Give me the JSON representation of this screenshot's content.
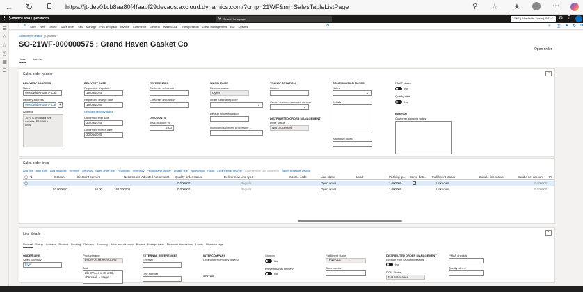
{
  "browser": {
    "url": "https://jt-dev01cb8aa80f4faabf29devaos.axcloud.dynamics.com/?cmp=21WF&mi=SalesTableListPage"
  },
  "appbar": {
    "app_name": "Finance and Operations",
    "search_placeholder": "Search for a page",
    "company": "21WF | Worldwide Foam (JBT US)"
  },
  "actionpane": {
    "items": [
      "Save",
      "New",
      "Delete",
      "Sales order",
      "Sell",
      "Manage",
      "Pick and pack",
      "Invoice",
      "Commerce",
      "General",
      "Warehouse",
      "Transportation",
      "Credit management",
      "EDI",
      "Options"
    ]
  },
  "page": {
    "breadcrumb": "Sales order details",
    "updated": "| Updated *",
    "title": "SO-21WF-000000575 : Grand Haven Gasket Co",
    "status": "Open order",
    "tabs": [
      "Lines",
      "Header"
    ]
  },
  "header": {
    "section_title": "Sales order header",
    "delivery_address": {
      "heading": "DELIVERY ADDRESS",
      "name_label": "Name",
      "name_value": "Worldwide Foam - Cali",
      "delivery_label": "Delivery address",
      "delivery_value": "Worldwide Foam - Cali",
      "address_label": "Address",
      "address_lines": [
        "1570 S Archibald Ave",
        "Arcadia, PA 00613",
        "USA"
      ]
    },
    "delivery_date": {
      "heading": "DELIVERY DATE",
      "req_ship_label": "Requested ship date",
      "req_ship_value": "19/05/2025",
      "req_receipt_label": "Requested receipt date",
      "req_receipt_value": "19/05/2025",
      "simulate": "Simulate delivery dates",
      "conf_ship_label": "Confirmed ship date",
      "conf_ship_value": "30/05/2025",
      "conf_receipt_label": "Confirmed receipt date",
      "conf_receipt_value": "30/05/2025"
    },
    "references": {
      "heading": "REFERENCES",
      "cust_ref_label": "Customer reference",
      "cust_req_label": "Customer requisition",
      "discounts_heading": "DISCOUNTS",
      "total_disc_label": "Total discount %",
      "total_disc_value": "2.00"
    },
    "warehouse": {
      "heading": "WAREHOUSE",
      "release_label": "Release status",
      "release_value": "Open",
      "fulfill_label": "Order fulfillment policy",
      "default_fulfill_label": "Default fulfillment policy",
      "outbound_label": "Outbound shipment processing ..."
    },
    "transportation": {
      "heading": "TRANSPORTATION",
      "routes_label": "Routes",
      "carrier_label": "Carrier customer account number",
      "dist_heading": "DISTRIBUTED ORDER MANAGEMENT",
      "dom_label": "DOM Status",
      "dom_value": "Not processed"
    },
    "confirmation": {
      "heading": "CONFIRMATION NOTES",
      "notes_label": "Notes",
      "details_label": "Details",
      "additional_label": "Additional notes"
    },
    "misc": {
      "pmap_label": "PMAP check",
      "pmap_value": "No",
      "quality_label": "Quality alert",
      "quality_value": "No",
      "banyan_heading": "BANYAN",
      "cust_ship_notes_label": "Customer shipping notes"
    }
  },
  "lines": {
    "section_title": "Sales order lines",
    "toolbar": [
      "Add line",
      "Add lines",
      "Add products",
      "Remove",
      "Deneals",
      "Sales order line",
      "Financials",
      "Inventory",
      "Product and supply",
      "Update line",
      "Warehouse",
      "Retail",
      "Engineering change",
      "Add revenue split child item",
      "Billing schedule details"
    ],
    "columns": [
      "Discount",
      "Discount percent",
      "Net amount",
      "Adjusted net amount",
      "Quality order status",
      "Deliver now",
      "Line type",
      "Source code",
      "Line status",
      "Load",
      "Packing qu...",
      "Same batc...",
      "Fulfillment status",
      "Bundle line status",
      "Bundle net amount",
      "Pr"
    ],
    "rows": [
      {
        "discount": "",
        "discount_percent": "",
        "net_amount": "",
        "adjusted": "0.000000",
        "line_type": "Regular",
        "line_status": "Open order",
        "packing": "1.000000",
        "fulfillment": "Unknown",
        "bundle_net": "0.000000"
      },
      {
        "discount": "50.000000",
        "discount_percent": "10.00",
        "net_amount": "162.000000",
        "adjusted": "0.000000",
        "line_type": "Regular",
        "line_status": "Open order",
        "packing": "1.000000",
        "fulfillment": "Unknown",
        "bundle_net": "0.000000"
      }
    ]
  },
  "line_details": {
    "section_title": "Line details",
    "tabs": [
      "General",
      "Setup",
      "Address",
      "Product",
      "Packing",
      "Delivery",
      "Sourcing",
      "Price and discount",
      "Project",
      "Foreign trade",
      "Financial dimensions",
      "Loads",
      "Financial tags"
    ],
    "order_line_heading": "ORDER LINE",
    "sales_category_label": "Sales category",
    "sales_category_value": "EVA",
    "product_name_label": "Product name",
    "product_name_value": "EV-2X-4-48-06-SH-CH",
    "text_label": "Text",
    "text_value": "2lb EVA, 4 x 48 x 96, charcoal, 1 stage",
    "ext_ref_heading": "EXTERNAL REFERENCES",
    "external_label": "External",
    "line_number_label": "Line number",
    "intercompany_heading": "INTERCOMPANY",
    "origin_label": "Origin (Intercompany orders)",
    "status_heading": "STATUS",
    "stopped_label": "Stopped",
    "stopped_value": "No",
    "prevent_label": "Prevent partial delivery",
    "prevent_value": "No",
    "fulfill_status_label": "Fulfillment status",
    "fulfill_status_value": "Unknown",
    "store_label": "Store number",
    "dist_heading": "DISTRIBUTED ORDER MANAGEMENT",
    "exclude_label": "Exclude from DOM processing",
    "exclude_value": "No",
    "dom_status_label": "DOM Status",
    "dom_status_value": "Not processed",
    "pmap_label": "PMAP check #",
    "quality_label": "Quality alert #"
  },
  "colors": {
    "accent": "#0f6cbd",
    "appbar": "#ffffff",
    "selected_row": "#deecf9"
  }
}
